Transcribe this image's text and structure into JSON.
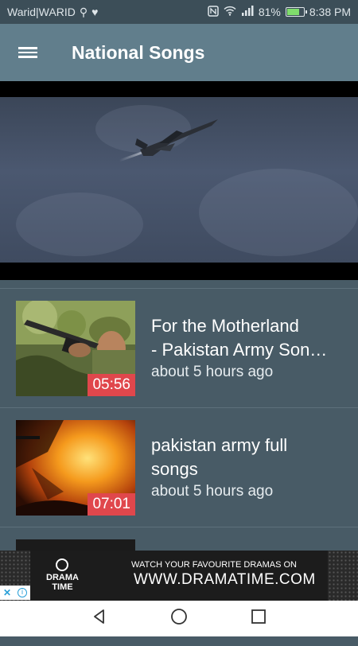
{
  "status": {
    "carrier": "Warid|WARID",
    "battery": "81%",
    "battery_level": 0.81,
    "time": "8:38 PM"
  },
  "app_bar": {
    "title": "National Songs"
  },
  "videos": [
    {
      "title": "For the Motherland\n- Pakistan Army Son…",
      "time": "about 5 hours ago",
      "duration": "05:56"
    },
    {
      "title": "pakistan army full\nsongs",
      "time": "about 5 hours ago",
      "duration": "07:01"
    }
  ],
  "ad": {
    "brand": "DRAMA\nTIME",
    "tagline": "WATCH YOUR FAVOURITE DRAMAS ON",
    "url": "WWW.DRAMATIME.COM"
  },
  "colors": {
    "app_bar": "#617e8c",
    "background": "#485b66",
    "duration_badge": "#e0474c"
  }
}
